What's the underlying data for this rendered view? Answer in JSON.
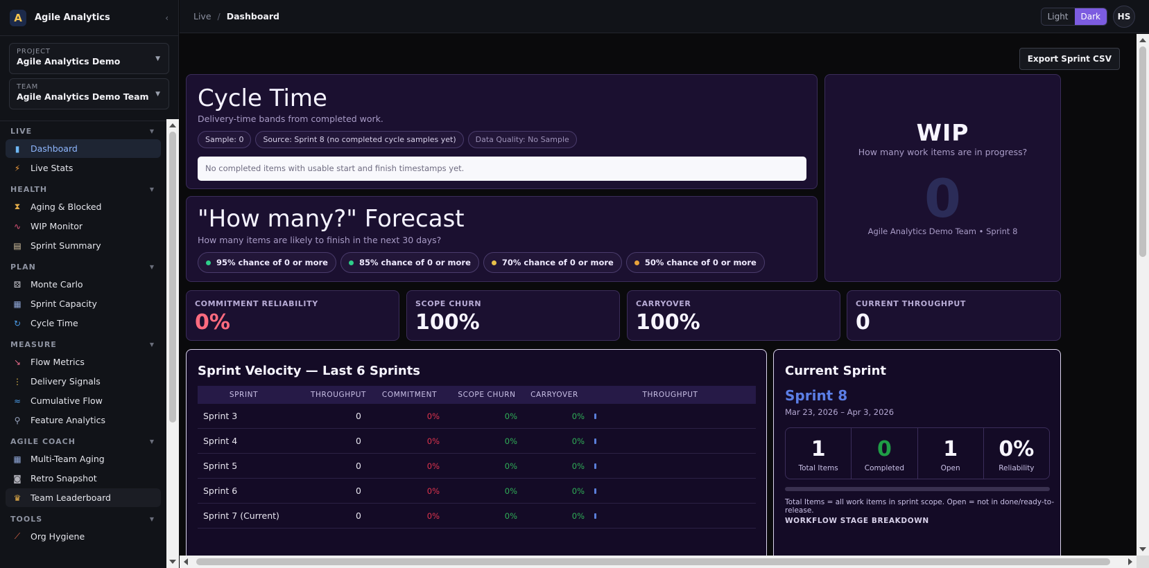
{
  "brand": {
    "name": "Agile Analytics",
    "logo_letter": "A"
  },
  "selectors": {
    "project": {
      "label": "PROJECT",
      "value": "Agile Analytics Demo"
    },
    "team": {
      "label": "TEAM",
      "value": "Agile Analytics Demo Team"
    }
  },
  "nav": {
    "live": {
      "label": "LIVE",
      "items": [
        {
          "label": "Dashboard",
          "icon": "bar-chart-icon",
          "color": "#6fb8f5"
        },
        {
          "label": "Live Stats",
          "icon": "lightning-icon",
          "color": "#f39c3c"
        }
      ]
    },
    "health": {
      "label": "HEALTH",
      "items": [
        {
          "label": "Aging & Blocked",
          "icon": "hourglass-icon",
          "color": "#e8b04a"
        },
        {
          "label": "WIP Monitor",
          "icon": "line-chart-icon",
          "color": "#e0547a"
        },
        {
          "label": "Sprint Summary",
          "icon": "clipboard-icon",
          "color": "#d9c7a4"
        }
      ]
    },
    "plan": {
      "label": "PLAN",
      "items": [
        {
          "label": "Monte Carlo",
          "icon": "dice-icon",
          "color": "#d0d0d8"
        },
        {
          "label": "Sprint Capacity",
          "icon": "calendar-icon",
          "color": "#8fa6d6"
        },
        {
          "label": "Cycle Time",
          "icon": "refresh-icon",
          "color": "#4a9be8"
        }
      ]
    },
    "measure": {
      "label": "MEASURE",
      "items": [
        {
          "label": "Flow Metrics",
          "icon": "trend-down-icon",
          "color": "#e86a8a"
        },
        {
          "label": "Delivery Signals",
          "icon": "traffic-light-icon",
          "color": "#e8c04a"
        },
        {
          "label": "Cumulative Flow",
          "icon": "wave-icon",
          "color": "#4a9be8"
        },
        {
          "label": "Feature Analytics",
          "icon": "microscope-icon",
          "color": "#9aa6c0"
        }
      ]
    },
    "coach": {
      "label": "AGILE COACH",
      "items": [
        {
          "label": "Multi-Team Aging",
          "icon": "calendar-icon",
          "color": "#8fa6d6"
        },
        {
          "label": "Retro Snapshot",
          "icon": "camera-icon",
          "color": "#b0b0b8"
        },
        {
          "label": "Team Leaderboard",
          "icon": "trophy-icon",
          "color": "#e8b04a"
        }
      ]
    },
    "tools": {
      "label": "TOOLS",
      "items": [
        {
          "label": "Org Hygiene",
          "icon": "broom-icon",
          "color": "#e86a4a"
        }
      ]
    }
  },
  "breadcrumb": {
    "parent": "Live",
    "sep": "/",
    "current": "Dashboard"
  },
  "theme": {
    "light": "Light",
    "dark": "Dark"
  },
  "user": {
    "initials": "HS"
  },
  "export_label": "Export Sprint CSV",
  "cycle_time": {
    "title": "Cycle Time",
    "subtitle": "Delivery-time bands from completed work.",
    "pills": [
      "Sample: 0",
      "Source: Sprint 8 (no completed cycle samples yet)",
      "Data Quality: No Sample"
    ],
    "empty_text": "No completed items with usable start and finish timestamps yet."
  },
  "forecast": {
    "title": "\"How many?\" Forecast",
    "subtitle": "How many items are likely to finish in the next 30 days?",
    "pills": [
      {
        "label": "95% chance of 0 or more",
        "color": "#2ecf8a"
      },
      {
        "label": "85% chance of 0 or more",
        "color": "#2ecf8a"
      },
      {
        "label": "70% chance of 0 or more",
        "color": "#e8c04a"
      },
      {
        "label": "50% chance of 0 or more",
        "color": "#e8a23a"
      }
    ]
  },
  "wip": {
    "title": "WIP",
    "subtitle": "How many work items are in progress?",
    "value": "0",
    "footer": "Agile Analytics Demo Team • Sprint 8"
  },
  "kpis": [
    {
      "label": "COMMITMENT RELIABILITY",
      "value": "0%"
    },
    {
      "label": "SCOPE CHURN",
      "value": "100%"
    },
    {
      "label": "CARRYOVER",
      "value": "100%"
    },
    {
      "label": "CURRENT THROUGHPUT",
      "value": "0"
    }
  ],
  "velocity": {
    "title": "Sprint Velocity — Last 6 Sprints",
    "columns": [
      "SPRINT",
      "THROUGHPUT",
      "COMMITMENT",
      "SCOPE CHURN",
      "CARRYOVER",
      "THROUGHPUT"
    ],
    "rows": [
      {
        "sprint": "Sprint 3",
        "throughput": "0",
        "commitment": "0%",
        "churn": "0%",
        "carryover": "0%"
      },
      {
        "sprint": "Sprint 4",
        "throughput": "0",
        "commitment": "0%",
        "churn": "0%",
        "carryover": "0%"
      },
      {
        "sprint": "Sprint 5",
        "throughput": "0",
        "commitment": "0%",
        "churn": "0%",
        "carryover": "0%"
      },
      {
        "sprint": "Sprint 6",
        "throughput": "0",
        "commitment": "0%",
        "churn": "0%",
        "carryover": "0%"
      },
      {
        "sprint": "Sprint 7 (Current)",
        "throughput": "0",
        "commitment": "0%",
        "churn": "0%",
        "carryover": "0%"
      }
    ]
  },
  "current_sprint": {
    "title": "Current Sprint",
    "name": "Sprint 8",
    "dates": "Mar 23, 2026 – Apr 3, 2026",
    "stats": [
      {
        "value": "1",
        "label": "Total Items"
      },
      {
        "value": "0",
        "label": "Completed"
      },
      {
        "value": "1",
        "label": "Open"
      },
      {
        "value": "0%",
        "label": "Reliability"
      }
    ],
    "progress_fraction": 0,
    "note": "Total Items = all work items in sprint scope. Open = not in done/ready-to-release.",
    "section_label": "WORKFLOW STAGE BREAKDOWN"
  }
}
